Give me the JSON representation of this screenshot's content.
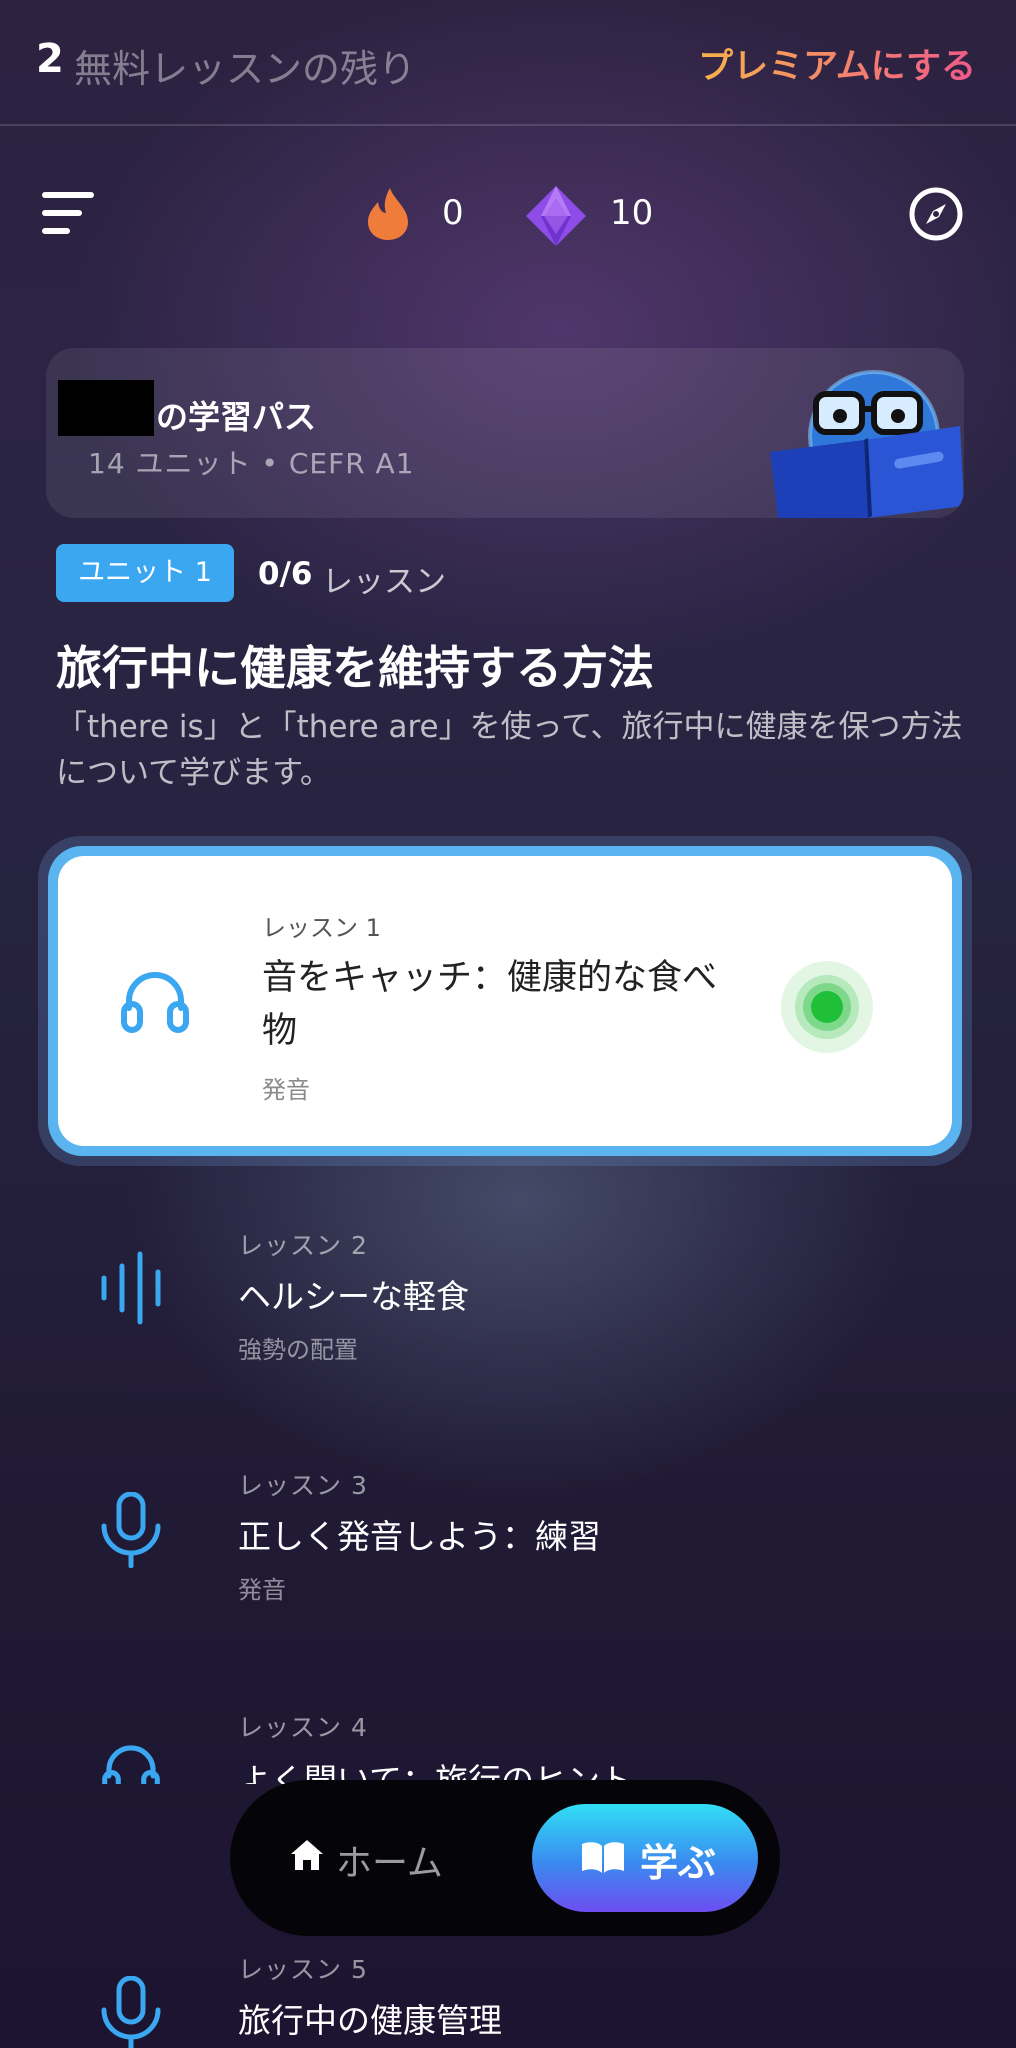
{
  "topbar": {
    "free_count": "2",
    "free_label": "無料レッスンの残り",
    "premium_label": "プレミアムにする"
  },
  "header": {
    "menu_icon": "menu-icon",
    "streak_icon": "fire-icon",
    "streak_count": "0",
    "gem_icon": "gem-icon",
    "gem_count": "10",
    "compass_icon": "compass-icon"
  },
  "path": {
    "title": "の学習パス",
    "subtitle": "14 ユニット • CEFR A1"
  },
  "unit": {
    "badge": "ユニット 1",
    "progress_count": "0/6",
    "progress_label": "レッスン",
    "title": "旅行中に健康を維持する方法",
    "description": "「there is」と「there are」を使って、旅行中に健康を保つ方法について学びます。"
  },
  "lessons": [
    {
      "number": "レッスン 1",
      "title": "音をキャッチ：健康的な食べ物",
      "category": "発音",
      "icon": "headphones-icon",
      "status": "current"
    },
    {
      "number": "レッスン 2",
      "title": "ヘルシーな軽食",
      "category": "強勢の配置",
      "icon": "waveform-icon"
    },
    {
      "number": "レッスン 3",
      "title": "正しく発音しよう：練習",
      "category": "発音",
      "icon": "microphone-icon"
    },
    {
      "number": "レッスン 4",
      "title": "よく聞いて：旅行のヒント",
      "category": "",
      "icon": "headphones-icon"
    },
    {
      "number": "レッスン 5",
      "title": "旅行中の健康管理",
      "category": "",
      "icon": "microphone-icon"
    }
  ],
  "nav": {
    "home_label": "ホーム",
    "learn_label": "学ぶ"
  },
  "colors": {
    "accent_blue": "#3aa7f0",
    "premium_gradient_start": "#f7b24b",
    "premium_gradient_end": "#f05a8a",
    "status_green": "#1fbf3a"
  }
}
